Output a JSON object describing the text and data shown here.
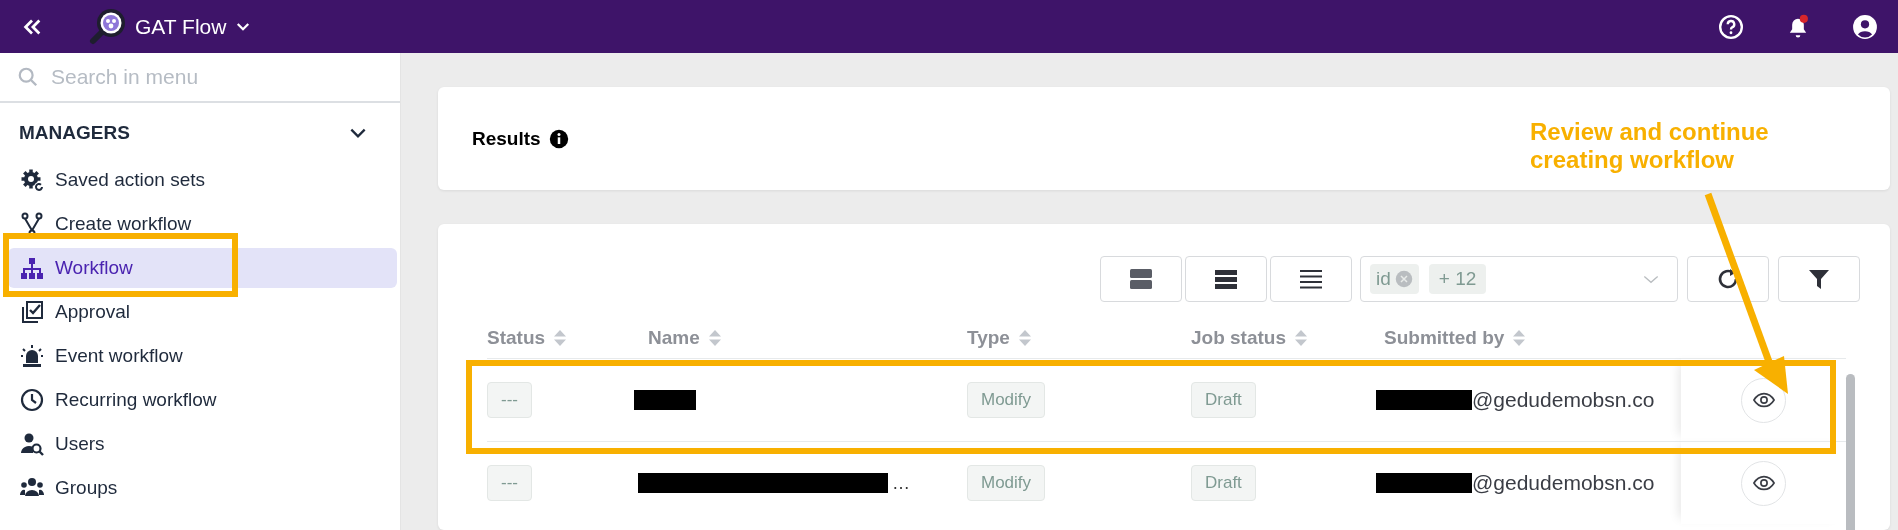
{
  "topbar": {
    "app_name": "GAT Flow",
    "has_unread_notifications": true
  },
  "sidebar": {
    "search": {
      "placeholder": "Search in menu"
    },
    "section": {
      "title": "MANAGERS",
      "expanded": true
    },
    "items": [
      {
        "label": "Saved action sets",
        "selected": false
      },
      {
        "label": "Create workflow",
        "selected": false
      },
      {
        "label": "Workflow",
        "selected": true
      },
      {
        "label": "Approval",
        "selected": false
      },
      {
        "label": "Event workflow",
        "selected": false
      },
      {
        "label": "Recurring workflow",
        "selected": false
      },
      {
        "label": "Users",
        "selected": false
      },
      {
        "label": "Groups",
        "selected": false
      }
    ]
  },
  "results": {
    "title": "Results"
  },
  "table": {
    "column_chips": [
      "id"
    ],
    "more_columns": "+ 12",
    "columns": [
      "Status",
      "Name",
      "Type",
      "Job status",
      "Submitted by"
    ],
    "rows": [
      {
        "status": "---",
        "name": {
          "redacted": true
        },
        "type": "Modify",
        "job_status": "Draft",
        "submitted_by": "@gedudemobsn.co"
      },
      {
        "status": "---",
        "name": {
          "redacted": true,
          "text": "…"
        },
        "type": "Modify",
        "job_status": "Draft",
        "submitted_by": "@gedudemobsn.co"
      }
    ]
  },
  "annotation": {
    "text": "Review and continue creating workflow"
  }
}
